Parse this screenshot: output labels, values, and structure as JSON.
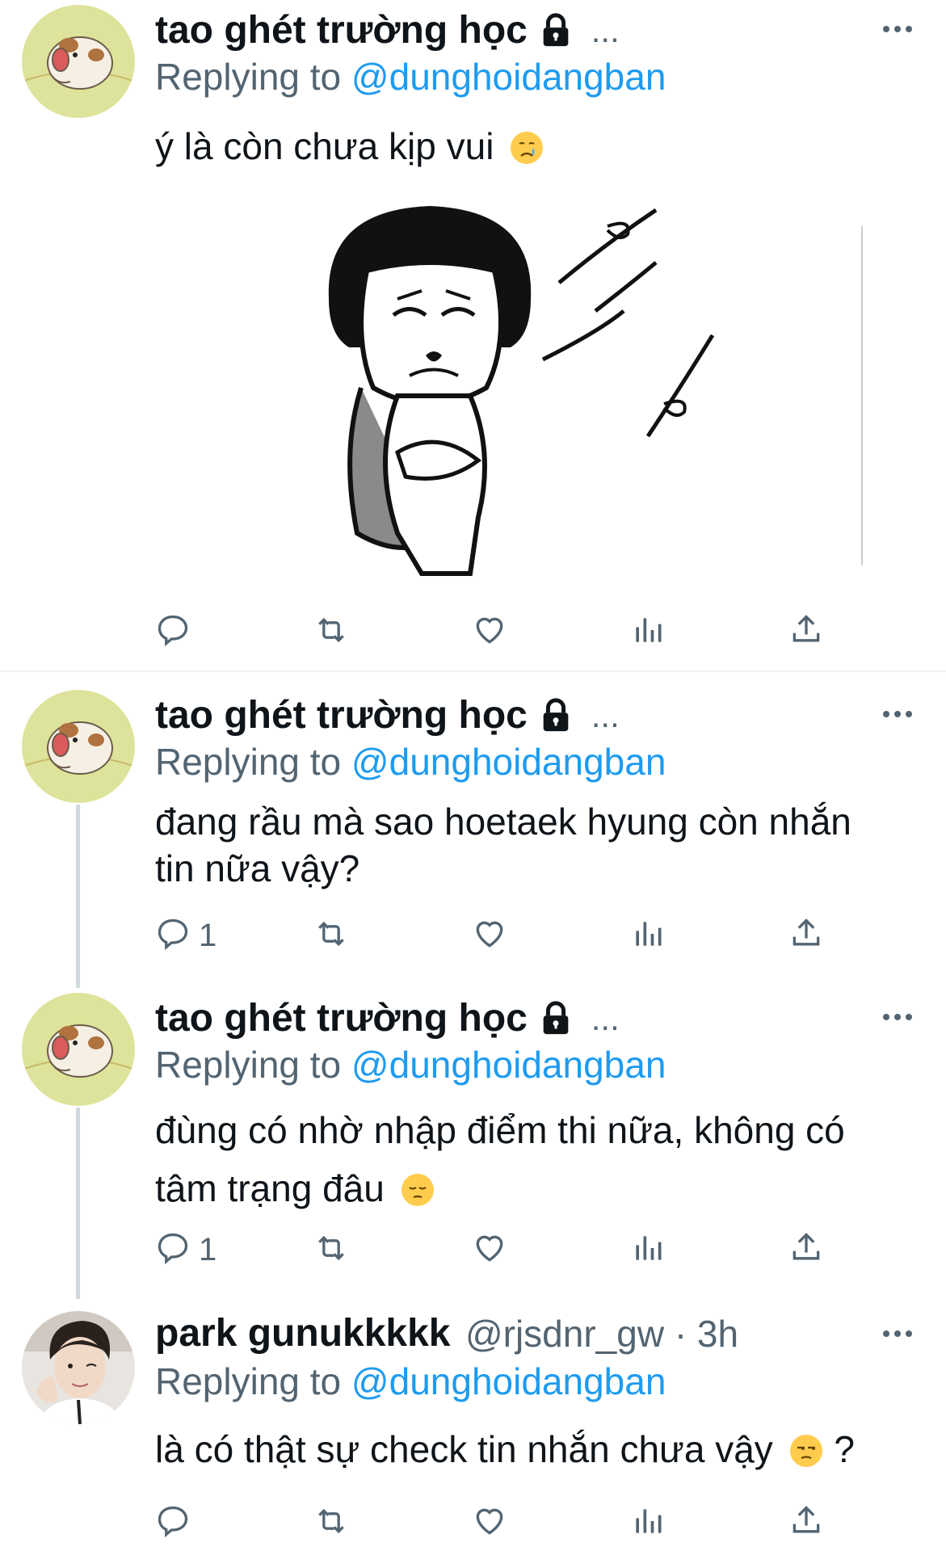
{
  "tweets": [
    {
      "name": "tao ghét trường học",
      "handle_truncated": "...",
      "replying_prefix": "Replying to",
      "replying_to": "@dunghoidangban",
      "text": "ý là còn chưa kịp vui",
      "emoji": "crying-face-icon",
      "has_media": true,
      "reply_count": ""
    },
    {
      "name": "tao ghét trường học",
      "handle_truncated": "...",
      "replying_prefix": "Replying to",
      "replying_to": "@dunghoidangban",
      "text_line1": "đang rầu mà sao hoetaek hyung còn nhắn",
      "text_line2": "tin nữa vậy?",
      "reply_count": "1"
    },
    {
      "name": "tao ghét trường học",
      "handle_truncated": "...",
      "replying_prefix": "Replying to",
      "replying_to": "@dunghoidangban",
      "text_line1": "đùng có nhờ nhập điểm thi nữa, không có",
      "text_line2": "tâm trạng đâu",
      "emoji": "pensive-face-icon",
      "reply_count": "1"
    },
    {
      "name": "park gunukkkkk",
      "handle": "@rjsdnr_gw · 3h",
      "replying_prefix": "Replying to",
      "replying_to": "@dunghoidangban",
      "text": "là có thật sự check tin nhắn chưa vậy",
      "emoji": "unamused-face-icon",
      "text_suffix": "?",
      "reply_count": ""
    }
  ],
  "colors": {
    "accent": "#1d9bf0",
    "secondary_text": "#536471",
    "thread_line": "#cfd9de"
  }
}
